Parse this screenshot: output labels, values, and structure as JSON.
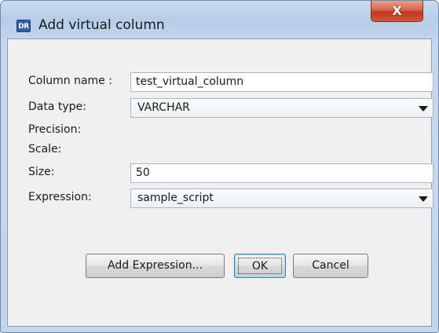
{
  "window": {
    "title": "Add virtual column",
    "app_icon_text": "DR",
    "close_glyph": "X"
  },
  "form": {
    "column_name": {
      "label": "Column name :",
      "value": "test_virtual_column"
    },
    "data_type": {
      "label": "Data type:",
      "selected": "VARCHAR"
    },
    "precision": {
      "label": "Precision:"
    },
    "scale": {
      "label": "Scale:"
    },
    "size": {
      "label": "Size:",
      "value": "50"
    },
    "expression": {
      "label": "Expression:",
      "selected": "sample_script"
    }
  },
  "buttons": {
    "add_expression": "Add Expression...",
    "ok": "OK",
    "cancel": "Cancel"
  },
  "icons": {
    "app": "app-logo-icon",
    "close": "close-icon",
    "dropdown": "chevron-down-icon"
  },
  "colors": {
    "close_button": "#c2381d",
    "title_bar": "#b7cde8",
    "client_bg": "#f0f0f0",
    "ok_focus_border": "#3c7fb1"
  }
}
